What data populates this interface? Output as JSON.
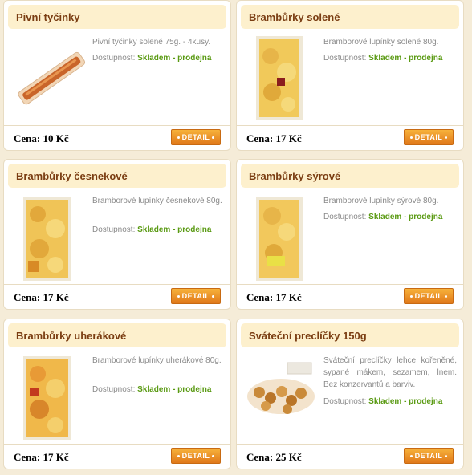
{
  "cards": [
    {
      "title": "Pivní tyčinky",
      "description": "Pivní tyčinky solené 75g. - 4kusy.",
      "availability_label": "Dostupnost:",
      "availability_value": "Skladem - prodejna",
      "price": "Cena: 10 Kč",
      "button": "DETAIL"
    },
    {
      "title": "Brambůrky solené",
      "description": "Bramborové lupínky solené 80g.",
      "availability_label": "Dostupnost:",
      "availability_value": "Skladem - prodejna",
      "price": "Cena: 17 Kč",
      "button": "DETAIL"
    },
    {
      "title": "Brambůrky česnekové",
      "description": "Bramborové lupínky česnekové 80g.",
      "availability_label": "Dostupnost:",
      "availability_value": "Skladem - prodejna",
      "price": "Cena: 17 Kč",
      "button": "DETAIL"
    },
    {
      "title": "Brambůrky sýrové",
      "description": "Bramborové lupínky sýrové 80g.",
      "availability_label": "Dostupnost:",
      "availability_value": "Skladem - prodejna",
      "price": "Cena: 17 Kč",
      "button": "DETAIL"
    },
    {
      "title": "Brambůrky uherákové",
      "description": "Bramborové lupínky uherákové 80g.",
      "availability_label": "Dostupnost:",
      "availability_value": "Skladem - prodejna",
      "price": "Cena: 17 Kč",
      "button": "DETAIL"
    },
    {
      "title": "Sváteční preclíčky 150g",
      "description": "Sváteční preclíčky lehce kořeněné, sypané mákem, sezamem, lnem. Bez konzervantů a barviv.",
      "availability_label": "Dostupnost:",
      "availability_value": "Skladem - prodejna",
      "price": "Cena: 25 Kč",
      "button": "DETAIL"
    }
  ],
  "colors": {
    "background": "#f5ecd8",
    "card_header": "#fdf0cd",
    "title": "#7a3d12",
    "availability": "#5a9a13",
    "button": "#e0781a"
  }
}
